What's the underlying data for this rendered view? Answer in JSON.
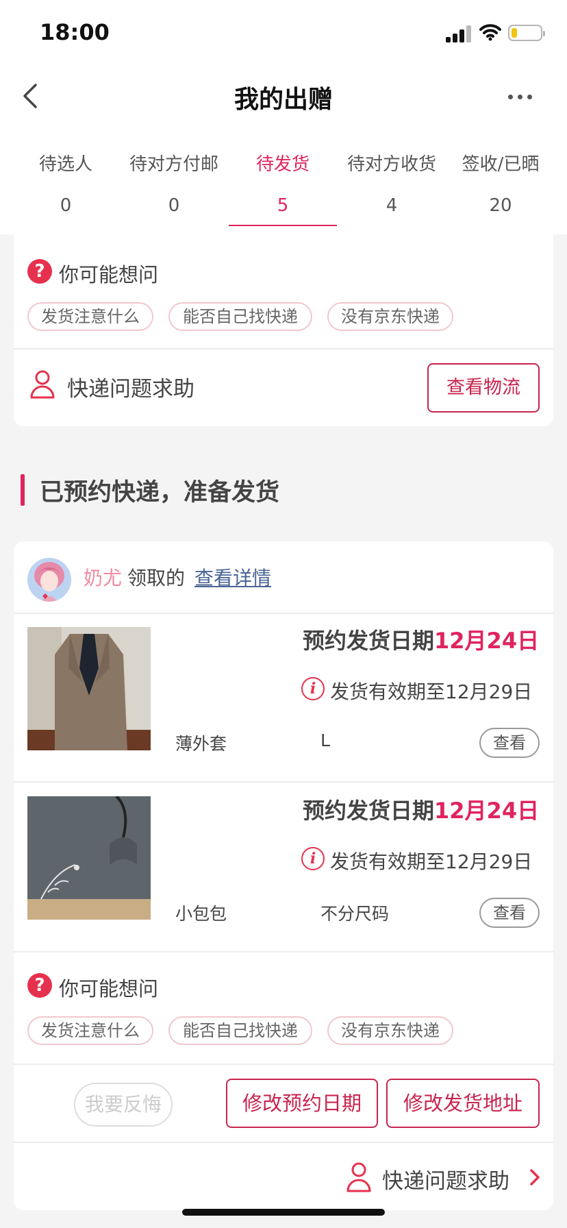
{
  "status_bar": {
    "time": "18:00"
  },
  "header": {
    "title": "我的出赠"
  },
  "tabs": [
    {
      "label": "待选人",
      "count": "0"
    },
    {
      "label": "待对方付邮",
      "count": "0"
    },
    {
      "label": "待发货",
      "count": "5"
    },
    {
      "label": "待对方收货",
      "count": "4"
    },
    {
      "label": "签收/已晒",
      "count": "20"
    }
  ],
  "active_tab_index": 2,
  "card1": {
    "faq_title": "你可能想问",
    "chips": [
      "发货注意什么",
      "能否自己找快递",
      "没有京东快递"
    ],
    "help_text": "快递问题求助",
    "logistics_button": "查看物流"
  },
  "section": {
    "title": "已预约快递，准备发货"
  },
  "order": {
    "user_name": "奶尤",
    "taken_text": "领取的",
    "detail_link": "查看详情",
    "items": [
      {
        "ship_label": "预约发货日期",
        "ship_date": "12月24日",
        "validity": "发货有效期至12月29日",
        "name": "薄外套",
        "size": "L",
        "view_button": "查看"
      },
      {
        "ship_label": "预约发货日期",
        "ship_date": "12月24日",
        "validity": "发货有效期至12月29日",
        "name": "小包包",
        "size": "不分尺码",
        "view_button": "查看"
      }
    ],
    "faq_title": "你可能想问",
    "chips": [
      "发货注意什么",
      "能否自己找快递",
      "没有京东快递"
    ],
    "regret_button": "我要反悔",
    "change_date_button": "修改预约日期",
    "change_address_button": "修改发货地址",
    "help_text": "快递问题求助"
  },
  "colors": {
    "accent": "#e0245e",
    "question": "#e6314e",
    "link": "#4a6494",
    "background": "#f4f4f4"
  }
}
